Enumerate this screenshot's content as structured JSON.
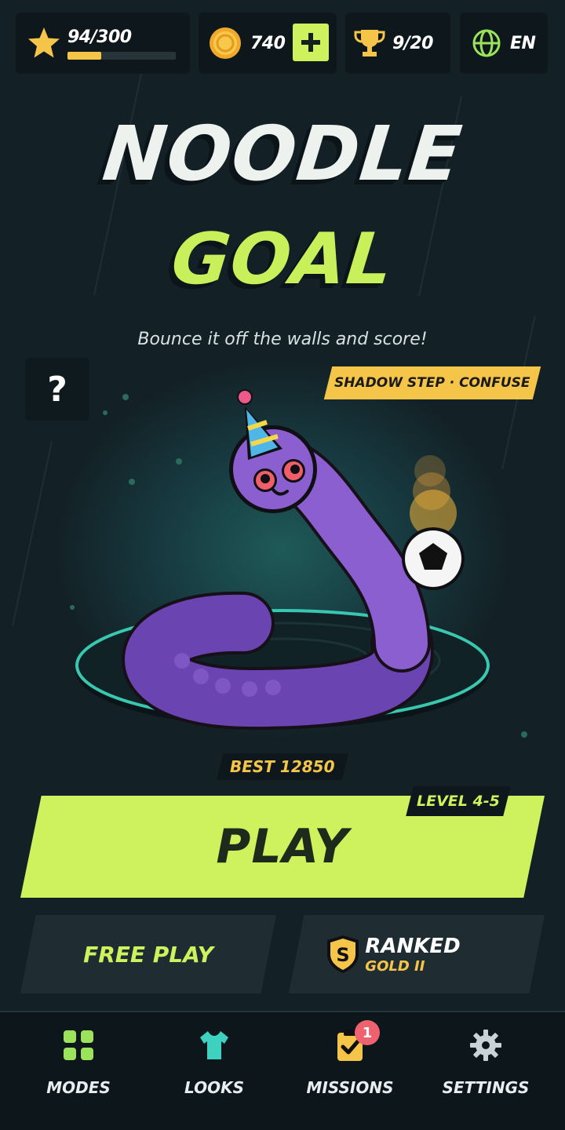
{
  "top_bar": {
    "xp": {
      "icon": "star-icon",
      "text": "94/300",
      "progress": 0.31
    },
    "coins": {
      "icon": "coin-icon",
      "text": "740",
      "add_icon": "plus-icon"
    },
    "trophies": {
      "icon": "trophy-icon",
      "text": "9/20"
    },
    "language": {
      "icon": "globe-icon",
      "text": "EN"
    }
  },
  "title": {
    "line1": "NOODLE",
    "line2": "GOAL"
  },
  "subtitle": "Bounce it off the walls and score!",
  "help": {
    "icon": "question-icon",
    "text": "?"
  },
  "ability_tag": "SHADOW STEP · CONFUSE",
  "best_score": "BEST 12850",
  "play": {
    "label": "PLAY",
    "level": "LEVEL 4-5"
  },
  "modes": {
    "free_play": "FREE PLAY",
    "ranked": {
      "label": "RANKED",
      "tier": "GOLD II",
      "badge_letter": "S"
    }
  },
  "nav": {
    "items": [
      {
        "label": "MODES",
        "icon": "grid-icon"
      },
      {
        "label": "LOOKS",
        "icon": "shirt-icon"
      },
      {
        "label": "MISSIONS",
        "icon": "clipboard-check-icon",
        "badge": "1"
      },
      {
        "label": "SETTINGS",
        "icon": "gear-icon"
      }
    ]
  },
  "colors": {
    "accent_green": "#cdf25e",
    "accent_yellow": "#f5c54a",
    "snake_purple": "#8b5fcf",
    "background": "#132126"
  }
}
